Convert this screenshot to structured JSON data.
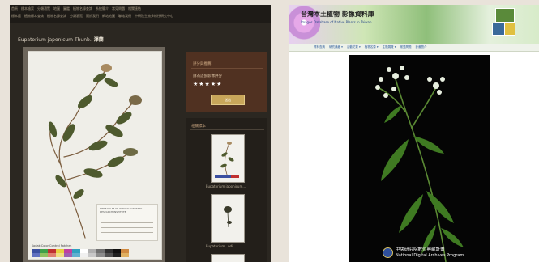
{
  "left_page": {
    "nav_row1": [
      "首頁",
      "標本檢索",
      "分類瀏覽",
      "地圖",
      "圖鑑",
      "植物名錄查詢",
      "系統簡介",
      "常見問題",
      "相關連結"
    ],
    "nav_row2": [
      "標本館",
      "植物標本查詢",
      "植物名錄查詢",
      "分類瀏覽",
      "關於我們",
      "網站地圖",
      "聯絡我們",
      "中研院生物多樣性研究中心"
    ],
    "specimen_title": "Eupatorium japonicum Thunb.",
    "specimen_title_zh": "澤蘭",
    "rating_panel": {
      "heading": "評分與推薦",
      "subheading": "請為這張影像評分",
      "stars": "★★★★★",
      "button_label": "送出"
    },
    "related_panel": {
      "heading": "相關標本",
      "thumb_captions": [
        "Eupatorium japonicum...",
        "Eupatorium...ndi..."
      ]
    },
    "specimen_caption": "HERBARIUM OF TAIWAN FORESTRY RESEARCH INSTITUTE",
    "color_chart_caption": "Kodak Color Control Patches"
  },
  "right_page": {
    "banner_title": "台灣本土植物 影像資料庫",
    "banner_subtitle": "Images Database of Native Plants in Taiwan",
    "menu": [
      "資料查詢",
      "研究典藏 ▾",
      "活動花絮 ▾",
      "植物名錄 ▾",
      "主題展覽 ▾",
      "常見問題",
      "計畫簡介"
    ],
    "archive_name_zh": "中央研究院數位典藏計畫",
    "archive_name_en": "National Digital Archives Program"
  },
  "colors": {
    "left_bg": "#2b2721",
    "rating_panel": "#503121",
    "button_gold": "#c8a65a",
    "right_bg": "#ffffff",
    "photo_bg": "#050505"
  },
  "icons": [
    "star-icon",
    "archive-logo-icon"
  ]
}
